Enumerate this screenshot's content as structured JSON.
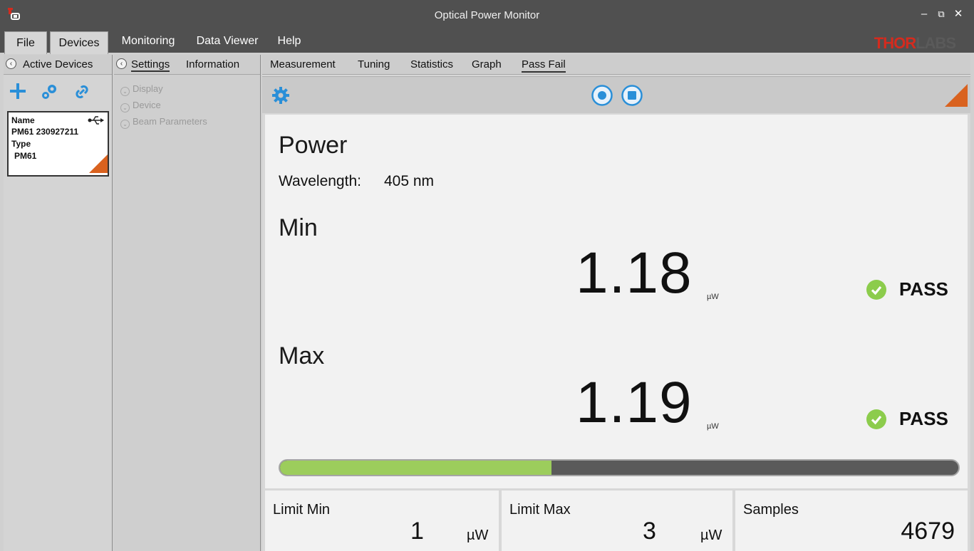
{
  "window": {
    "title": "Optical Power Monitor",
    "minimize_glyph": "–",
    "restore_glyph": "⧉",
    "close_glyph": "✕"
  },
  "menu": {
    "items": [
      "File",
      "Devices",
      "Monitoring",
      "Data Viewer",
      "Help"
    ]
  },
  "logo": {
    "part_a": "THOR",
    "part_b": "LABS"
  },
  "left_panel": {
    "header": "Active Devices",
    "device": {
      "name_label": "Name",
      "name_value": "PM61 230927211",
      "type_label": "Type",
      "type_value": "PM61"
    }
  },
  "mid_panel": {
    "tabs": [
      "Settings",
      "Information"
    ],
    "items": [
      "Display",
      "Device",
      "Beam Parameters"
    ]
  },
  "main": {
    "tabs": [
      "Measurement",
      "Tuning",
      "Statistics",
      "Graph",
      "Pass Fail"
    ],
    "active_tab": "Pass Fail",
    "power_label": "Power",
    "wavelength_label": "Wavelength:",
    "wavelength_value": "405 nm",
    "min": {
      "label": "Min",
      "value": "1.18",
      "unit": "µW",
      "status": "PASS"
    },
    "max": {
      "label": "Max",
      "value": "1.19",
      "unit": "µW",
      "status": "PASS"
    },
    "progress_fraction": 0.4,
    "stats": {
      "limit_min": {
        "label": "Limit Min",
        "value": "1",
        "unit": "µW"
      },
      "limit_max": {
        "label": "Limit Max",
        "value": "3",
        "unit": "µW"
      },
      "samples": {
        "label": "Samples",
        "value": "4679"
      }
    }
  },
  "colors": {
    "accent_blue": "#2a8fd8",
    "accent_orange": "#d9621f",
    "pass_green": "#8ccc4c",
    "progress_green": "#9ccd5c"
  }
}
